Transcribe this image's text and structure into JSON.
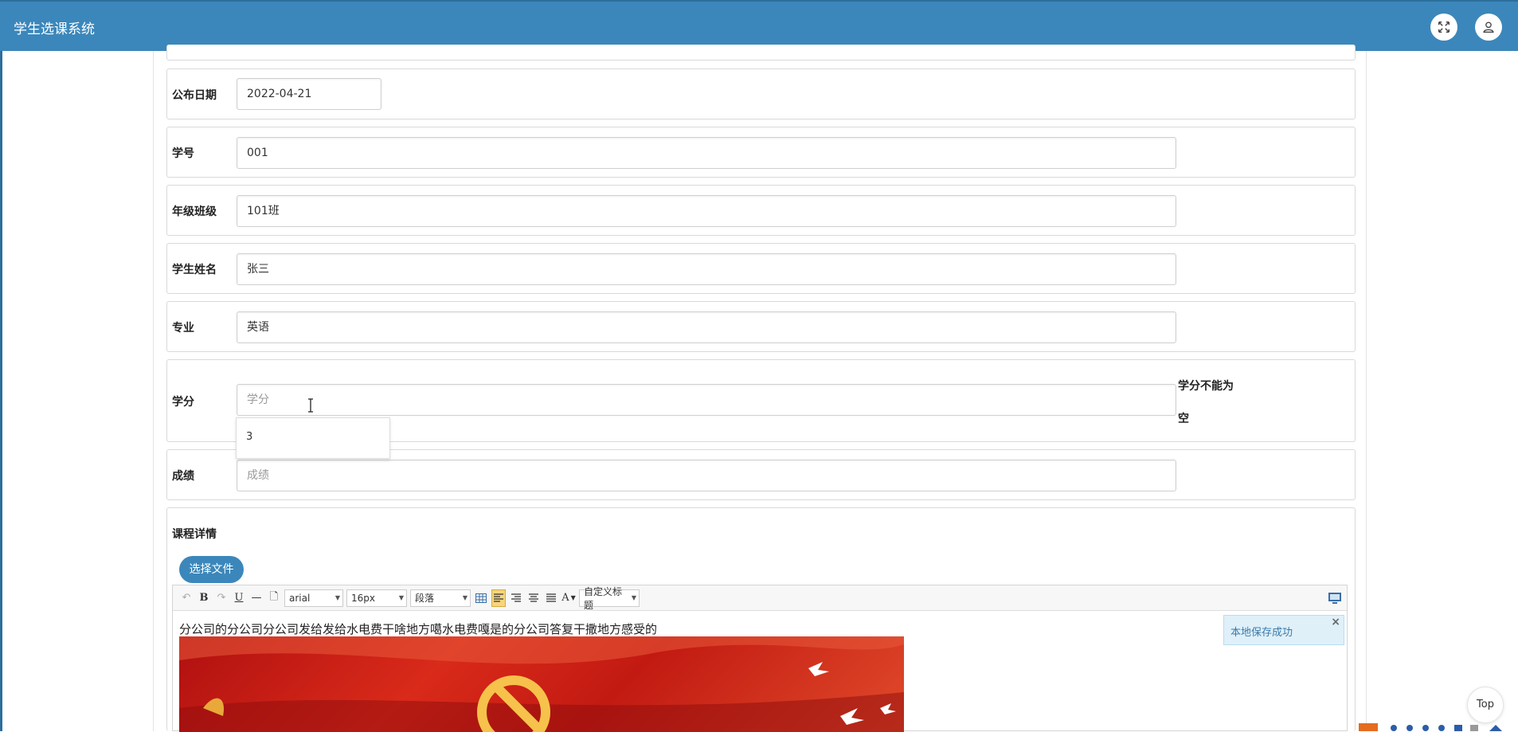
{
  "app": {
    "title": "学生选课系统"
  },
  "header": {
    "fullscreen_icon": "expand-icon",
    "user_icon": "user-icon"
  },
  "form": {
    "publish_date": {
      "label": "公布日期",
      "value": "2022-04-21"
    },
    "student_no": {
      "label": "学号",
      "value": "001"
    },
    "class": {
      "label": "年级班级",
      "value": "101班"
    },
    "student_name": {
      "label": "学生姓名",
      "value": "张三"
    },
    "major": {
      "label": "专业",
      "value": "英语"
    },
    "credit": {
      "label": "学分",
      "placeholder": "学分",
      "error_line1": "学分不能为",
      "error_line2": "空",
      "suggestion": "3"
    },
    "score": {
      "label": "成绩",
      "placeholder": "成绩"
    },
    "course_detail": {
      "label": "课程详情",
      "file_button": "选择文件"
    }
  },
  "editor": {
    "toolbar": {
      "font": "arial",
      "size": "16px",
      "paragraph": "段落",
      "custom_title": "自定义标题"
    },
    "content_text": "分公司的分公司分公司发给发给水电费干啥地方噶水电费嘎是的分公司答复干撒地方感受的"
  },
  "toast": {
    "message": "本地保存成功"
  },
  "back_to_top": "Top",
  "colors": {
    "primary": "#3b87bb",
    "toast_bg": "#dff0f9"
  }
}
